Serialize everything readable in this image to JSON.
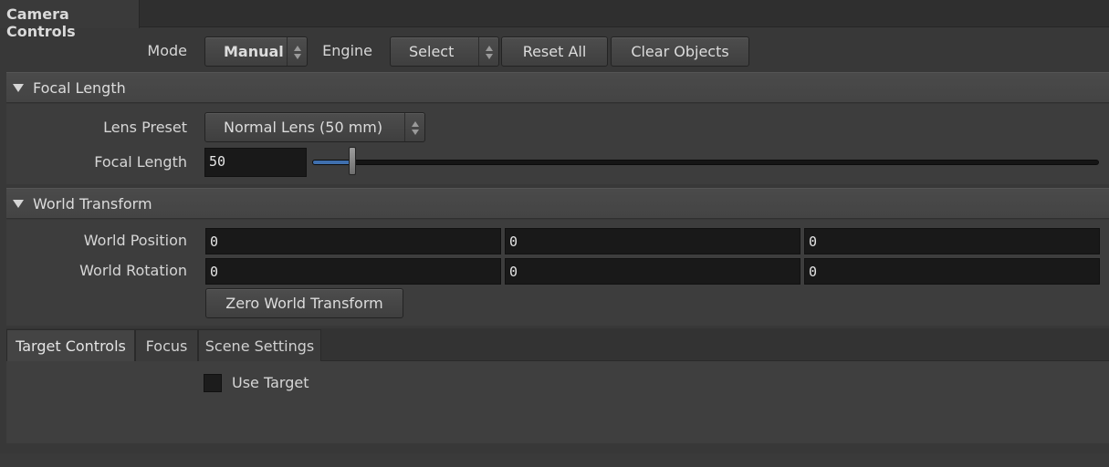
{
  "panel": {
    "title": "Camera Controls"
  },
  "toolbar": {
    "mode_label": "Mode",
    "mode_value": "Manual",
    "engine_label": "Engine",
    "engine_value": "Select",
    "reset_all": "Reset All",
    "clear_objects": "Clear Objects"
  },
  "focal_section": {
    "title": "Focal Length",
    "lens_preset_label": "Lens Preset",
    "lens_preset_value": "Normal Lens (50 mm)",
    "focal_length_label": "Focal Length",
    "focal_length_value": "50",
    "slider_fraction": 0.048
  },
  "world_section": {
    "title": "World Transform",
    "position_label": "World Position",
    "position": [
      "0",
      "0",
      "0"
    ],
    "rotation_label": "World Rotation",
    "rotation": [
      "0",
      "0",
      "0"
    ],
    "zero_button": "Zero World Transform"
  },
  "tabs": [
    {
      "label": "Target Controls",
      "active": true
    },
    {
      "label": "Focus",
      "active": false
    },
    {
      "label": "Scene Settings",
      "active": false
    }
  ],
  "target_panel": {
    "use_target_label": "Use Target",
    "use_target_checked": false
  },
  "colors": {
    "accent": "#3f6fae",
    "background": "#383838",
    "field": "#191919"
  }
}
